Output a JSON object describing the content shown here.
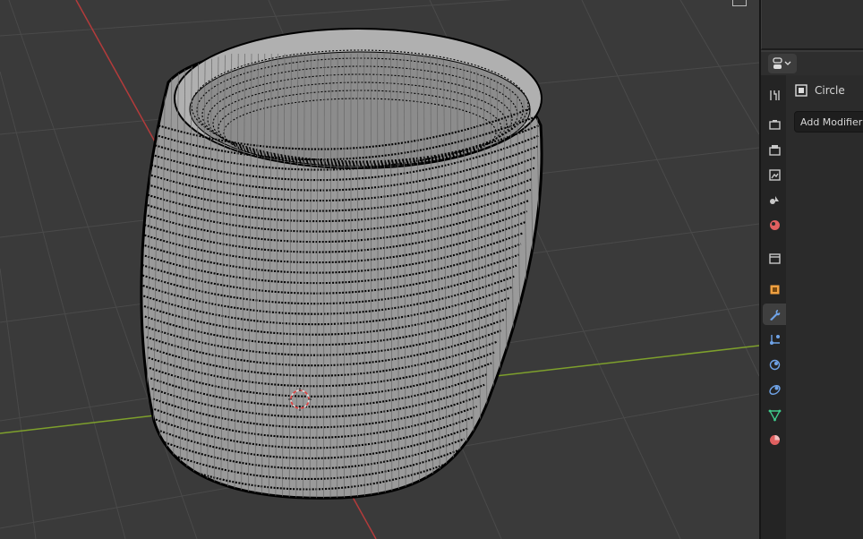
{
  "properties": {
    "object_name": "Circle",
    "add_modifier_label": "Add Modifier",
    "active_tab": "modifier",
    "tabs": [
      {
        "name": "tool",
        "icon": "tool-icon",
        "color": "#c8c8c8"
      },
      {
        "name": "render",
        "icon": "render-icon",
        "color": "#c8c8c8"
      },
      {
        "name": "output",
        "icon": "output-icon",
        "color": "#c8c8c8"
      },
      {
        "name": "view-layer",
        "icon": "view-layer-icon",
        "color": "#c8c8c8"
      },
      {
        "name": "scene",
        "icon": "scene-icon",
        "color": "#c8c8c8"
      },
      {
        "name": "world",
        "icon": "world-icon",
        "color": "#e06060"
      },
      {
        "name": "collection",
        "icon": "collection-icon",
        "color": "#c8c8c8"
      },
      {
        "name": "object",
        "icon": "object-icon",
        "color": "#f0a040"
      },
      {
        "name": "modifier",
        "icon": "wrench-icon",
        "color": "#6fa3e8"
      },
      {
        "name": "particles",
        "icon": "particles-icon",
        "color": "#6fa3e8"
      },
      {
        "name": "physics",
        "icon": "physics-icon",
        "color": "#6fa3e8"
      },
      {
        "name": "constraints",
        "icon": "constraints-icon",
        "color": "#6fa3e8"
      },
      {
        "name": "data",
        "icon": "mesh-data-icon",
        "color": "#3ec98a"
      },
      {
        "name": "material",
        "icon": "material-icon",
        "color": "#e06060"
      }
    ]
  },
  "colors": {
    "viewport_bg": "#3a3a3a",
    "grid_line": "#4a4a4a",
    "x_axis": "#b33b3b",
    "y_axis": "#7ea02c",
    "mesh_fill": "#9a9a9a",
    "wire": "#000000"
  }
}
